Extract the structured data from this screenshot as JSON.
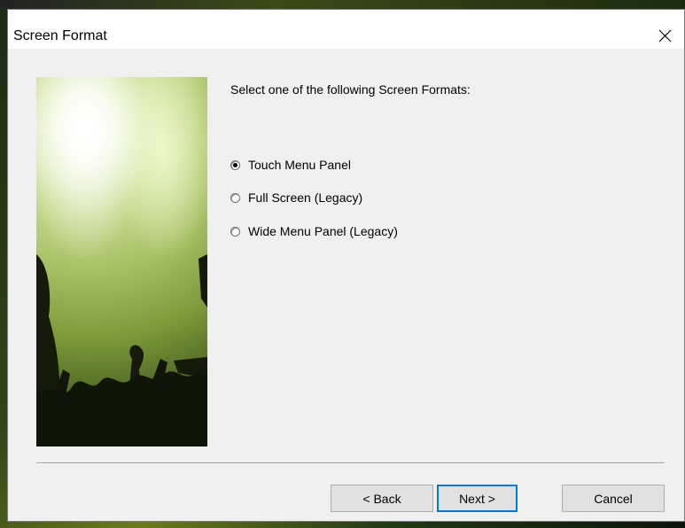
{
  "window": {
    "title": "Screen Format",
    "close_icon": "close-icon"
  },
  "content": {
    "prompt": "Select one of the following Screen Formats:",
    "options": [
      {
        "label": "Touch Menu Panel",
        "checked": true
      },
      {
        "label": "Full Screen (Legacy)",
        "checked": false
      },
      {
        "label": "Wide Menu Panel (Legacy)",
        "checked": false
      }
    ]
  },
  "buttons": {
    "back_label": "< Back",
    "next_label": "Next >",
    "cancel_label": "Cancel"
  },
  "colors": {
    "dialog_bg": "#f0f0f0",
    "title_bg": "#ffffff",
    "default_button_border": "#0078d7",
    "button_bg": "#e1e1e1"
  }
}
